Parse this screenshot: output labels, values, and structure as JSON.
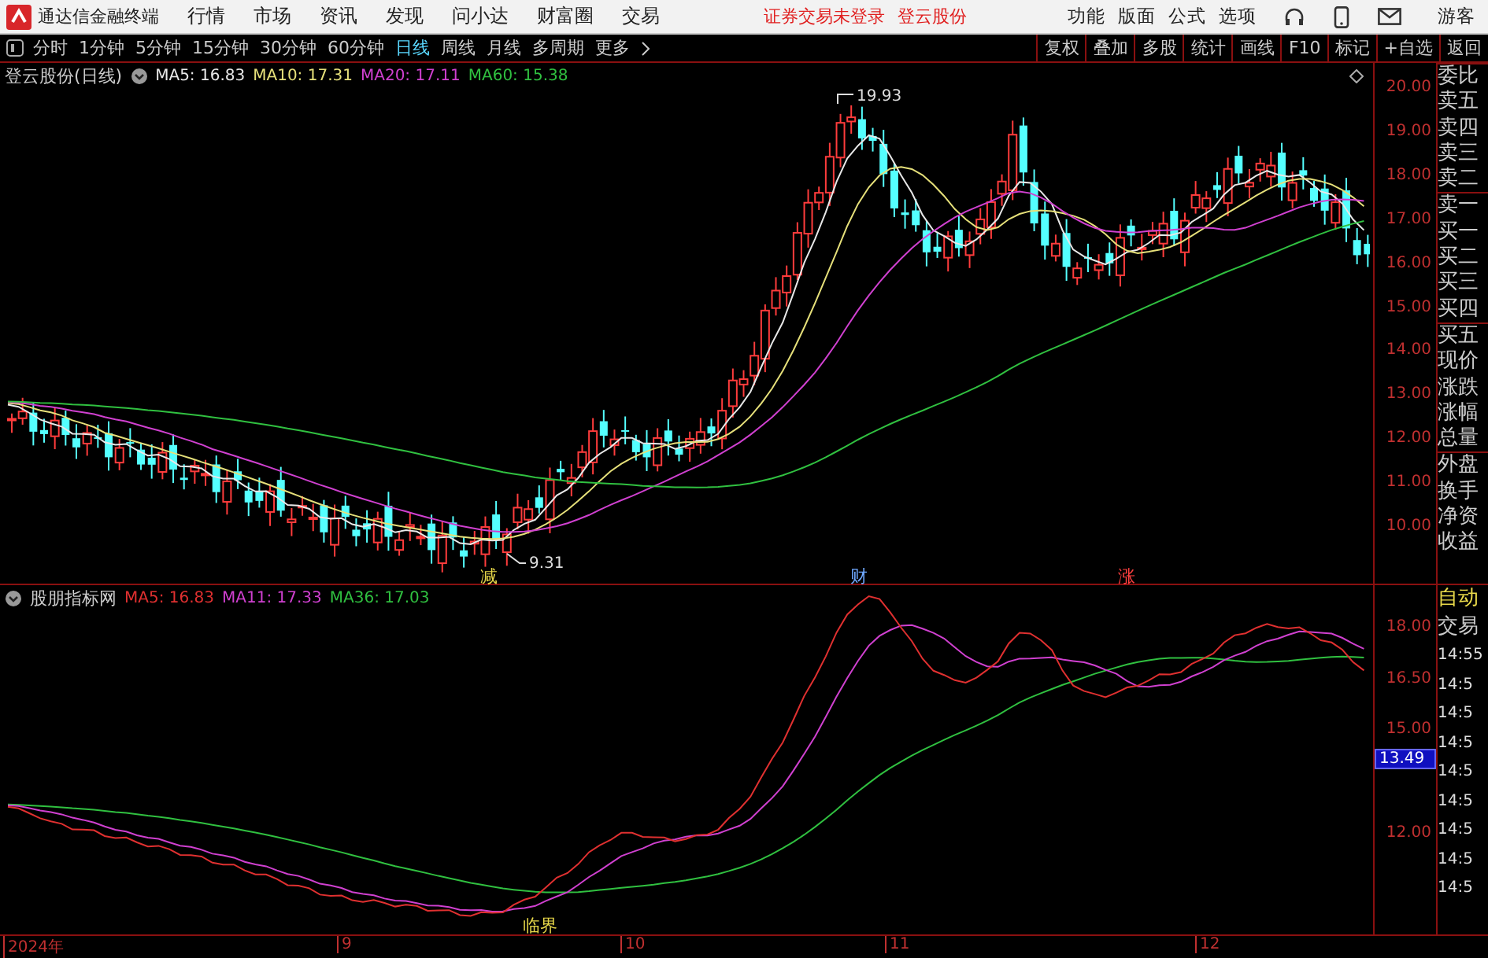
{
  "top_bar": {
    "app_title": "通达信金融终端",
    "menus": [
      "行情",
      "市场",
      "资讯",
      "发现",
      "问小达",
      "财富圈",
      "交易"
    ],
    "notices": [
      "证券交易未登录",
      "登云股份"
    ],
    "tools": [
      "功能",
      "版面",
      "公式",
      "选项"
    ],
    "user": "游客"
  },
  "toolbar": {
    "periods": [
      {
        "label": "分时",
        "selected": false
      },
      {
        "label": "1分钟",
        "selected": false
      },
      {
        "label": "5分钟",
        "selected": false
      },
      {
        "label": "15分钟",
        "selected": false
      },
      {
        "label": "30分钟",
        "selected": false
      },
      {
        "label": "60分钟",
        "selected": false
      },
      {
        "label": "日线",
        "selected": true
      },
      {
        "label": "周线",
        "selected": false
      },
      {
        "label": "月线",
        "selected": false
      },
      {
        "label": "多周期",
        "selected": false
      }
    ],
    "more": "更多",
    "actions": [
      "复权",
      "叠加",
      "多股",
      "统计",
      "画线",
      "F10",
      "标记",
      "+自选",
      "返回"
    ]
  },
  "price_chart": {
    "title": "登云股份(日线)",
    "indicators": [
      {
        "label": "MA5: 16.83",
        "color": "#e8e8e8"
      },
      {
        "label": "MA10: 17.31",
        "color": "#e6e07a"
      },
      {
        "label": "MA20: 17.11",
        "color": "#d040d0"
      },
      {
        "label": "MA60: 15.38",
        "color": "#30c040"
      }
    ],
    "high_label": "19.93",
    "low_label": "9.31",
    "axis_labels": [
      "20.00",
      "19.00",
      "18.00",
      "17.00",
      "16.00",
      "15.00",
      "14.00",
      "13.00",
      "12.00",
      "11.00",
      "10.00"
    ],
    "event_marks": [
      {
        "label": "减",
        "color": "#e8d84a"
      },
      {
        "label": "财",
        "color": "#6fa8ff"
      },
      {
        "label": "涨",
        "color": "#ff4040"
      }
    ]
  },
  "indicator_chart": {
    "title": "股朋指标网",
    "indicators": [
      {
        "label": "MA5: 16.83",
        "color": "#e03030"
      },
      {
        "label": "MA11: 17.33",
        "color": "#d040d0"
      },
      {
        "label": "MA36: 17.03",
        "color": "#30c040"
      }
    ],
    "axis_labels": [
      "18.00",
      "16.50",
      "15.00",
      "12.00"
    ],
    "cursor_value": "13.49",
    "signal_label": "临界"
  },
  "x_axis": [
    "2024年",
    "9",
    "10",
    "11",
    "12"
  ],
  "quote_panel": {
    "labels": [
      "委比",
      "卖五",
      "卖四",
      "卖三",
      "卖二",
      "卖一",
      "买一",
      "买二",
      "买三",
      "买四",
      "买五",
      "现价",
      "涨跌",
      "涨幅",
      "总量",
      "外盘",
      "换手",
      "净资",
      "收益"
    ],
    "mode": "自动",
    "trade_header": "交易",
    "times": [
      "14:55",
      "14:5",
      "14:5",
      "14:5",
      "14:5",
      "14:5",
      "14:5",
      "14:5",
      "14:5"
    ]
  }
}
